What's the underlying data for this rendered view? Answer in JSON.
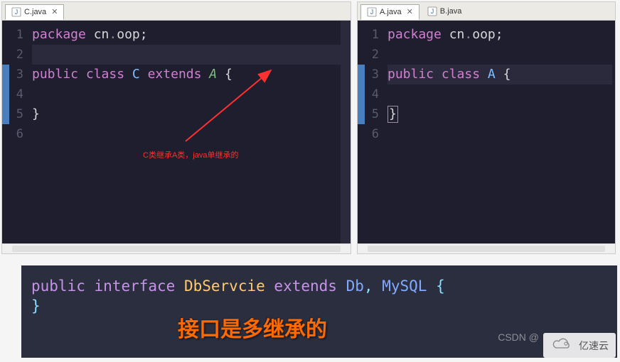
{
  "colors": {
    "keyword": "#d080d0",
    "class": "#7fbfff",
    "arrow": "#ff3030",
    "annotation": "#ff6a00"
  },
  "left_pane": {
    "tabs": [
      {
        "filename": "C.java",
        "active": true
      }
    ],
    "gutter": [
      "1",
      "2",
      "3",
      "4",
      "5",
      "6"
    ],
    "code": {
      "l1": {
        "kw": "package",
        "pkg1": "cn",
        "pkg2": "oop",
        "semi": ";"
      },
      "l3": {
        "kw1": "public",
        "kw2": "class",
        "cls": "C",
        "kw3": "extends",
        "super": "A",
        "brace": "{"
      },
      "l5": {
        "brace": "}"
      }
    },
    "annotation": "C类继承A类，java单继承的"
  },
  "right_pane": {
    "tabs": [
      {
        "filename": "A.java",
        "active": true
      },
      {
        "filename": "B.java",
        "active": false
      }
    ],
    "gutter": [
      "1",
      "2",
      "3",
      "4",
      "5",
      "6"
    ],
    "code": {
      "l1": {
        "kw": "package",
        "pkg1": "cn",
        "pkg2": "oop",
        "semi": ";"
      },
      "l3": {
        "kw1": "public",
        "kw2": "class",
        "cls": "A",
        "brace": "{"
      },
      "l5": {
        "brace": "}"
      }
    }
  },
  "interface_panel": {
    "l1": {
      "kw1": "public",
      "kw2": "interface",
      "name": "DbServcie",
      "kw3": "extends",
      "t1": "Db",
      "comma": ",",
      "t2": "MySQL",
      "brace": "{"
    },
    "l2": {
      "brace": "}"
    },
    "annotation": "接口是多继承的"
  },
  "watermark": {
    "csdn": "CSDN @",
    "brand": "亿速云"
  }
}
